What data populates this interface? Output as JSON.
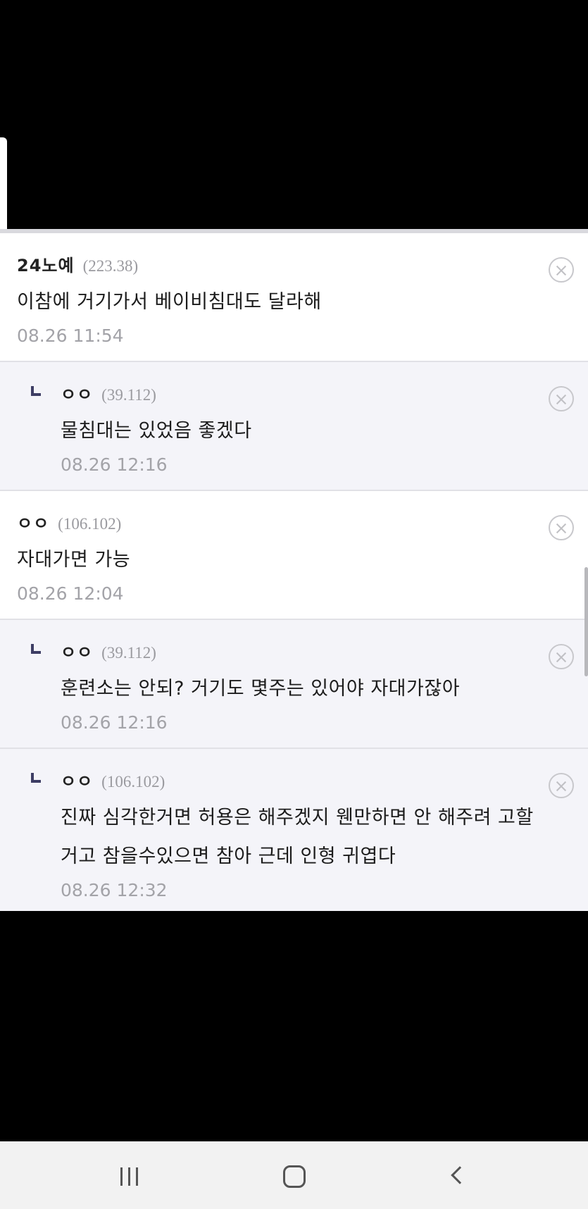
{
  "comments": [
    {
      "author": "24노예",
      "ip": "(223.38)",
      "text": "이참에 거기가서 베이비침대도 달라해",
      "time": "08.26 11:54"
    },
    {
      "author": "ㅇㅇ",
      "ip": "(39.112)",
      "text": "물침대는 있었음 좋겠다",
      "time": "08.26 12:16"
    },
    {
      "author": "ㅇㅇ",
      "ip": "(106.102)",
      "text": "자대가면 가능",
      "time": "08.26 12:04"
    },
    {
      "author": "ㅇㅇ",
      "ip": "(39.112)",
      "text": "훈련소는 안되? 거기도 몇주는 있어야 자대가잖아",
      "time": "08.26 12:16"
    },
    {
      "author": "ㅇㅇ",
      "ip": "(106.102)",
      "text": "진짜 심각한거면 허용은 해주겠지 웬만하면 안 해주려 고할거고 참을수있으면 참아 근데 인형 귀엽다",
      "time": "08.26 12:32"
    }
  ],
  "icons": {
    "delete": "circle-x-icon",
    "reply": "reply-arrow-icon",
    "nav_recent": "recent-apps-icon",
    "nav_home": "home-icon",
    "nav_back": "back-icon"
  }
}
